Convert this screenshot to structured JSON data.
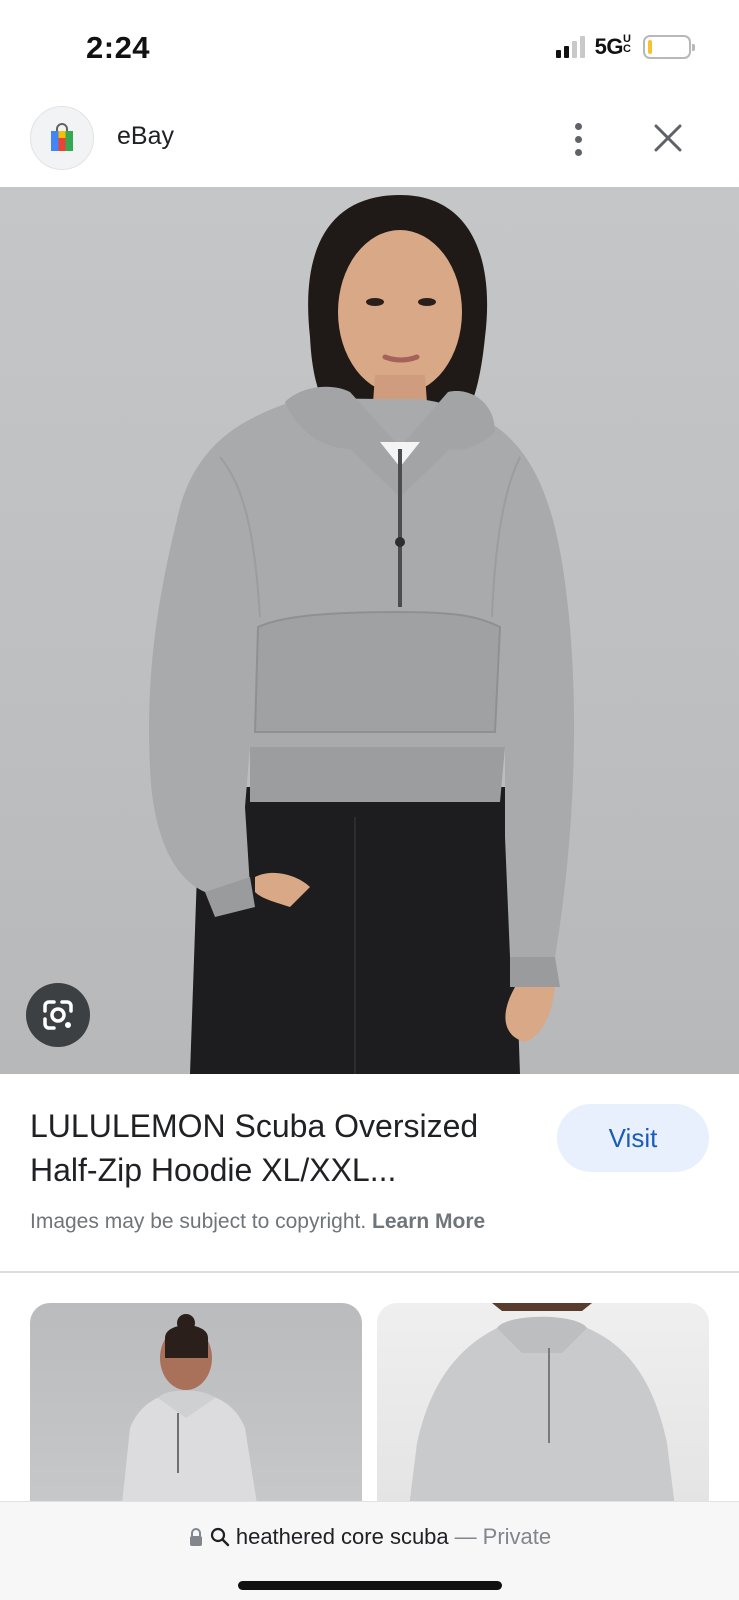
{
  "status_bar": {
    "time": "2:24",
    "network": "5G",
    "network_suffix": "UC",
    "battery_level": 0.1,
    "colors": {
      "battery_fill": "#f4c430"
    }
  },
  "header": {
    "site_name": "eBay",
    "site_icon": "shopping-bag-icon",
    "more_icon": "more-vertical-icon",
    "close_icon": "close-icon"
  },
  "main_image": {
    "lens_icon": "google-lens-icon"
  },
  "result": {
    "title": "LULULEMON Scuba Oversized Half-Zip Hoodie XL/XXL...",
    "visit_label": "Visit",
    "copyright_text": "Images may be subject to copyright.",
    "learn_more_label": "Learn More"
  },
  "bottom_bar": {
    "lock_icon": "lock-icon",
    "search_icon": "search-icon",
    "query": "heathered core scuba",
    "separator": "—",
    "mode": "Private"
  },
  "colors": {
    "accent": "#1a5db8",
    "visit_bg": "#e8f0fe"
  }
}
